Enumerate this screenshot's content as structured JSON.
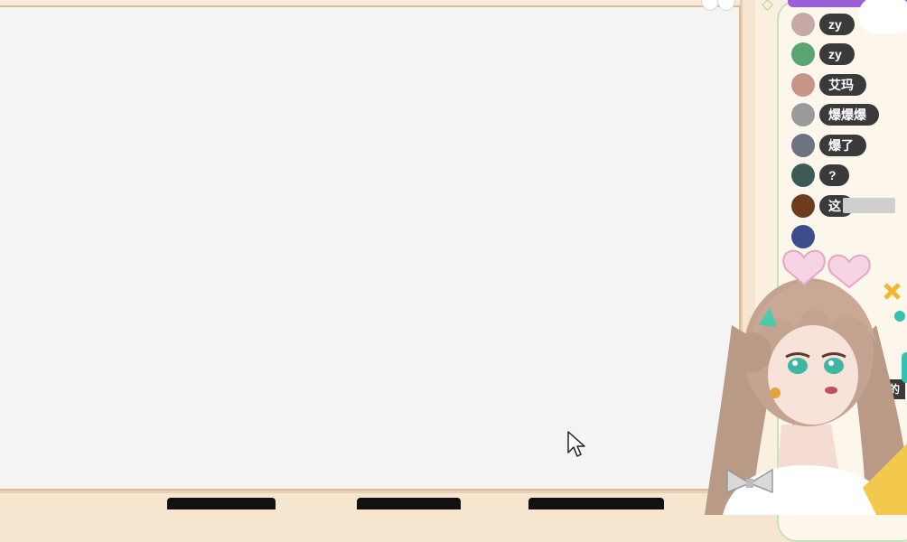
{
  "chat": {
    "messages": [
      {
        "text": "zy",
        "avatar_color": "#c8a7a7"
      },
      {
        "text": "zy",
        "avatar_color": "#5aa56f"
      },
      {
        "text": "艾玛",
        "avatar_color": "#c89486"
      },
      {
        "text": "爆爆爆",
        "avatar_color": "#9a9a9a"
      },
      {
        "text": "爆了",
        "avatar_color": "#6d7380"
      },
      {
        "text": "?",
        "avatar_color": "#3f5a55"
      },
      {
        "text": "这",
        "avatar_color": "#6e3b1f"
      },
      {
        "text": "",
        "avatar_color": "#3c4c8c"
      }
    ],
    "partial_label": "干的",
    "lower_avatars": [
      "#b06a6a",
      "#c9b0a2"
    ]
  },
  "colors": {
    "panel_bg": "#f7e6cf",
    "screen_bg": "#f4f4f4",
    "accent_purple": "#9a5ed6",
    "bubble_bg": "#3a3a3a"
  }
}
